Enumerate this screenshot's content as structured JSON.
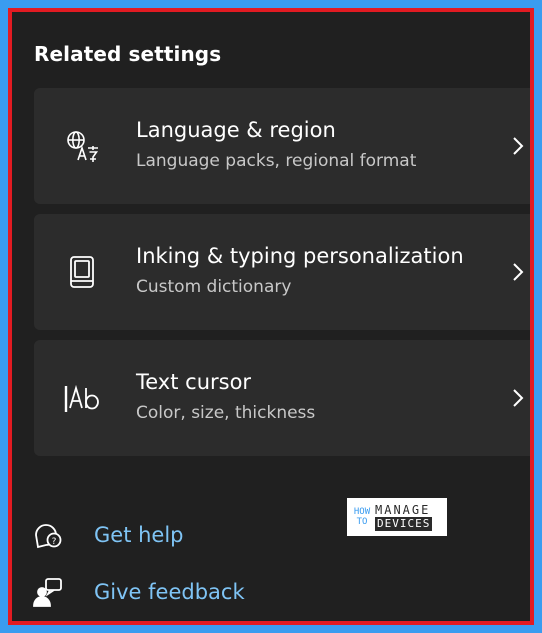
{
  "section": {
    "title": "Related settings"
  },
  "cards": [
    {
      "title": "Language & region",
      "subtitle": "Language packs, regional format",
      "icon": "language-icon"
    },
    {
      "title": "Inking & typing personalization",
      "subtitle": "Custom dictionary",
      "icon": "book-icon"
    },
    {
      "title": "Text cursor",
      "subtitle": "Color, size, thickness",
      "icon": "text-cursor-icon"
    }
  ],
  "links": [
    {
      "label": "Get help",
      "icon": "help-icon"
    },
    {
      "label": "Give feedback",
      "icon": "feedback-icon"
    }
  ],
  "logo": {
    "line1": "HOW",
    "line2": "TO",
    "line3": "MANAGE",
    "line4": "DEVICES"
  },
  "colors": {
    "background": "#202020",
    "card": "#2c2c2c",
    "link": "#7fc4f5",
    "frame_border": "#e21b22",
    "outer": "#3a9cf0"
  }
}
